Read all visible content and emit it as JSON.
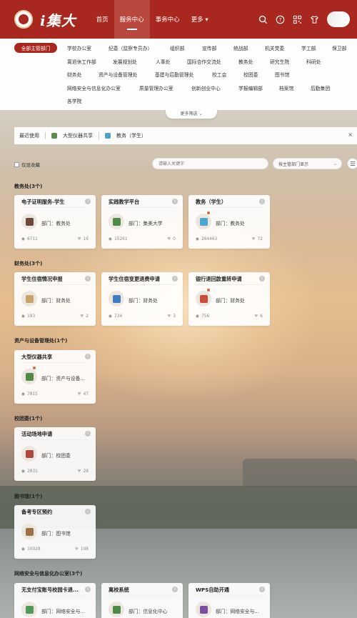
{
  "header": {
    "logo_text": "i集大",
    "nav": [
      {
        "label": "首页",
        "active": false
      },
      {
        "label": "服务中心",
        "active": true
      },
      {
        "label": "事务中心",
        "active": false
      },
      {
        "label": "更多 ▾",
        "active": false
      }
    ],
    "icons": [
      "search-icon",
      "help-icon",
      "qrcode-icon",
      "tshirt-icon",
      "user-avatar"
    ]
  },
  "departments": {
    "all_label": "全部主管部门",
    "items": [
      "学校办公室",
      "纪委（监察专员办）",
      "组织部",
      "宣传部",
      "统战部",
      "机关党委",
      "学工部",
      "保卫部",
      "离退休工作部",
      "发展规划处",
      "人事处",
      "国际合作交流处",
      "教务处",
      "研究生院",
      "科研处",
      "财务处",
      "资产与设备管理处",
      "基建与后勤管理处",
      "校工会",
      "校团委",
      "图书馆",
      "网络安全与信息化办公室",
      "质量管理办公室",
      "创新创业中心",
      "学报编辑部",
      "档案馆",
      "后勤集团",
      "各学院"
    ],
    "more_filter": "更多筛选 ⌄"
  },
  "recent": {
    "label": "最近使用",
    "items": [
      {
        "label": "大型仪器共享",
        "color": "#5a8f4e"
      },
      {
        "label": "教务（学生）",
        "color": "#4fa0c8"
      }
    ],
    "close": "×"
  },
  "filters": {
    "favorite_label": "仅显收藏",
    "search_placeholder": "请输入关键字",
    "dept_select": "按主管部门显示",
    "dept_select_chev": "⌄"
  },
  "sections": [
    {
      "title": "教务处(3个)",
      "cards": [
        {
          "title": "电子证明服务-学生",
          "dept": "部门：教务处",
          "views": "6711",
          "likes": "16",
          "icon_color": "#6b4a3a",
          "badge": false
        },
        {
          "title": "实践教学平台",
          "dept": "部门：集美大学",
          "views": "15261",
          "likes": "0",
          "icon_color": "#4d8a47",
          "badge": false
        },
        {
          "title": "教务（学生）",
          "dept": "部门：教务处",
          "views": "264463",
          "likes": "72",
          "icon_color": "#4aa6cf",
          "badge": true
        }
      ]
    },
    {
      "title": "财务处(3个)",
      "cards": [
        {
          "title": "学生住宿情况申报",
          "dept": "部门：财务处",
          "views": "193",
          "likes": "2",
          "icon_color": "#c9a36e",
          "badge": false
        },
        {
          "title": "学生住宿变更退费申请",
          "dept": "部门：财务处",
          "views": "734",
          "likes": "3",
          "icon_color": "#3f7fc1",
          "badge": false
        },
        {
          "title": "银行退回款重转申请",
          "dept": "部门：财务处",
          "views": "756",
          "likes": "6",
          "icon_color": "#c94d3a",
          "badge": true
        }
      ]
    },
    {
      "title": "资产与设备管理处(1个)",
      "cards": [
        {
          "title": "大型仪器共享",
          "dept": "部门：资产与设备...",
          "views": "7815",
          "likes": "47",
          "icon_color": "#4d8a47",
          "badge": true
        }
      ]
    },
    {
      "title": "校团委(1个)",
      "cards": [
        {
          "title": "活动场地申请",
          "dept": "部门：校团委",
          "views": "2831",
          "likes": "28",
          "icon_color": "#b0473c",
          "badge": false
        }
      ]
    },
    {
      "title": "图书馆(1个)",
      "cards": [
        {
          "title": "备考专区预约",
          "dept": "部门：图书馆",
          "views": "10028",
          "likes": "108",
          "icon_color": "#9a7048",
          "badge": false
        }
      ]
    },
    {
      "title": "网络安全与信息化办公室(3个)",
      "cards": [
        {
          "title": "无支付宝账号校园卡退...",
          "dept": "部门：网络安全与...",
          "views": "",
          "likes": "",
          "icon_color": "#4d9a5a",
          "badge": false
        },
        {
          "title": "离校系统",
          "dept": "部门：信息化中心",
          "views": "",
          "likes": "",
          "icon_color": "#4d8a47",
          "badge": false
        },
        {
          "title": "WPS自助开通",
          "dept": "部门：网络安全与...",
          "views": "",
          "likes": "",
          "icon_color": "#7a4fa0",
          "badge": false
        }
      ]
    }
  ]
}
